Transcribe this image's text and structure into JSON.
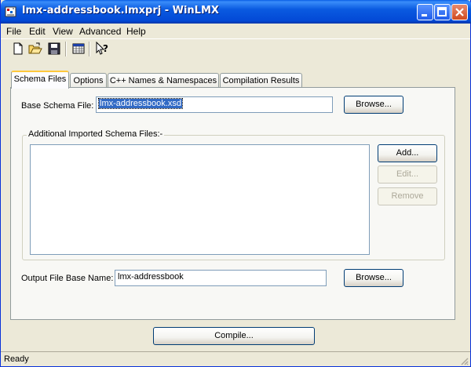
{
  "window": {
    "title": "lmx-addressbook.lmxprj - WinLMX"
  },
  "menu": [
    "File",
    "Edit",
    "View",
    "Advanced",
    "Help"
  ],
  "tabs": [
    "Schema Files",
    "Options",
    "C++ Names & Namespaces",
    "Compilation Results"
  ],
  "schema": {
    "base_label": "Base Schema File:",
    "base_value": "lmx-addressbook.xsd",
    "browse_label": "Browse...",
    "additional_label": "Additional Imported Schema Files:-",
    "add_label": "Add...",
    "edit_label": "Edit...",
    "remove_label": "Remove",
    "output_label": "Output File Base Name:",
    "output_value": "lmx-addressbook",
    "browse2_label": "Browse..."
  },
  "compile_label": "Compile...",
  "status": "Ready"
}
